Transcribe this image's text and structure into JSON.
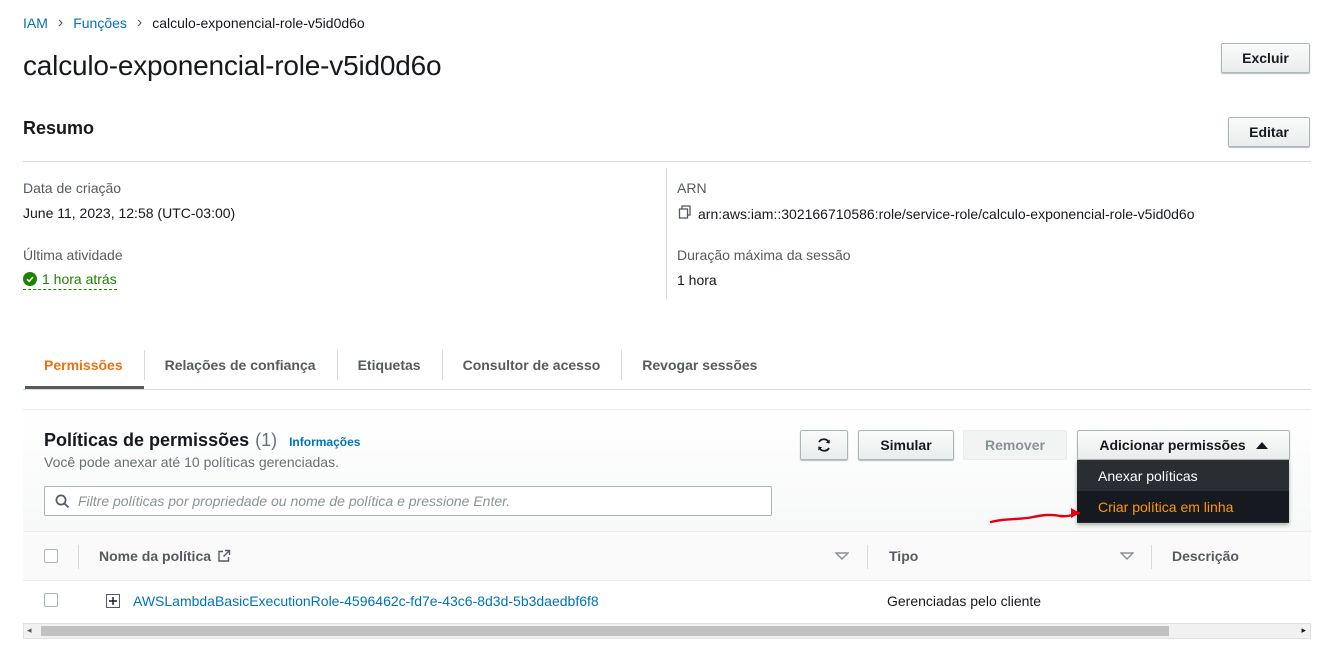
{
  "breadcrumb": {
    "items": [
      "IAM",
      "Funções"
    ],
    "current": "calculo-exponencial-role-v5id0d6o"
  },
  "page_title": "calculo-exponencial-role-v5id0d6o",
  "buttons": {
    "delete": "Excluir",
    "edit": "Editar"
  },
  "summary": {
    "title": "Resumo",
    "creation_label": "Data de criação",
    "creation_value": "June 11, 2023, 12:58 (UTC-03:00)",
    "last_activity_label": "Última atividade",
    "last_activity_value": "1 hora atrás",
    "arn_label": "ARN",
    "arn_value": "arn:aws:iam::302166710586:role/service-role/calculo-exponencial-role-v5id0d6o",
    "max_session_label": "Duração máxima da sessão",
    "max_session_value": "1 hora"
  },
  "tabs": [
    "Permissões",
    "Relações de confiança",
    "Etiquetas",
    "Consultor de acesso",
    "Revogar sessões"
  ],
  "policies": {
    "title": "Políticas de permissões",
    "count": "(1)",
    "info_link": "Informações",
    "subtitle": "Você pode anexar até 10 políticas gerenciadas.",
    "simulate": "Simular",
    "remove": "Remover",
    "add_permissions": "Adicionar permissões",
    "search_placeholder": "Filtre políticas por propriedade ou nome de política e pressione Enter.",
    "menu": [
      "Anexar políticas",
      "Criar política em linha"
    ],
    "columns": [
      "Nome da política",
      "Tipo",
      "Descrição"
    ],
    "rows": [
      {
        "name": "AWSLambdaBasicExecutionRole-4596462c-fd7e-43c6-8d3d-5b3daedbf6f8",
        "type": "Gerenciadas pelo cliente"
      }
    ]
  },
  "colors": {
    "link": "#0073bb",
    "active_tab": "#ec7211",
    "success": "#1d8102",
    "menu_bg": "#2a2e33",
    "menu_highlight": "#ff9900",
    "annotation": "#e3000f"
  }
}
